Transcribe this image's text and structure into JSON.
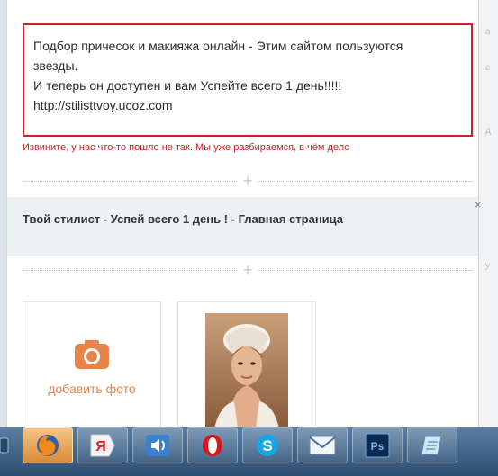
{
  "composer": {
    "lines": [
      "Подбор причесок и макияжа онлайн - Этим сайтом пользуются",
      "звезды.",
      "И теперь он доступен и вам Успейте всего 1 день!!!!!",
      "http://stilisttvoy.ucoz.com"
    ],
    "error": "Извините, у нас что-то пошло не так. Мы уже разбираемся, в чём дело"
  },
  "link_preview": {
    "title": "Твой стилист - Успей всего 1 день ! - Главная страница",
    "close": "×"
  },
  "divider_plus": "+",
  "attachments": {
    "add_photo_label": "добавить фото"
  },
  "taskbar": {
    "apps": [
      {
        "icon": "firefox-icon",
        "active": true
      },
      {
        "icon": "yandex-icon",
        "glyph": "Я"
      },
      {
        "icon": "audio-icon"
      },
      {
        "icon": "opera-icon"
      },
      {
        "icon": "skype-icon",
        "glyph": "S"
      },
      {
        "icon": "mail-icon"
      },
      {
        "icon": "photoshop-icon",
        "glyph": "Ps"
      },
      {
        "icon": "notepad-icon"
      }
    ]
  },
  "colors": {
    "accent_orange": "#e8844a",
    "error_red": "#cc2222",
    "preview_bg": "#edf1f4"
  }
}
